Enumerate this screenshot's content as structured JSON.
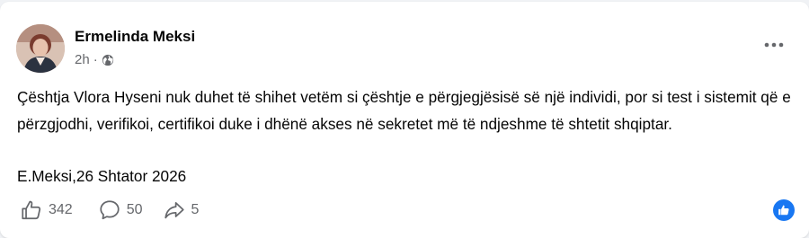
{
  "post": {
    "author": "Ermelinda Meksi",
    "timestamp": "2h",
    "separator": "·",
    "audience_icon": "globe-icon",
    "body": "Çështja Vlora Hyseni nuk duhet të shihet vetëm si çështje e përgjegjësisë së një individi, por si test i sistemit që e përzgjodhi, verifikoi, certifikoi duke i dhënë akses në sekretet më të ndjeshme të shtetit shqiptar.",
    "signature": "E.Meksi,26 Shtator 2026"
  },
  "actions": {
    "likes": "342",
    "comments": "50",
    "shares": "5"
  },
  "colors": {
    "accent": "#1877f2",
    "muted_text": "#65676b"
  }
}
